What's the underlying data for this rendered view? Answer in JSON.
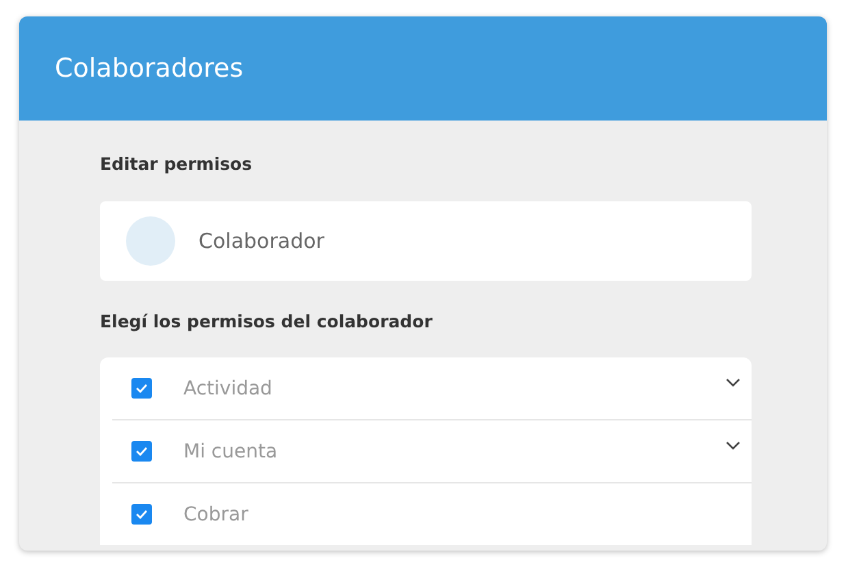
{
  "window": {
    "title": "Colaboradores"
  },
  "edit_section": {
    "heading": "Editar permisos",
    "collaborator": {
      "name": "Colaborador"
    }
  },
  "permissions_section": {
    "heading": "Elegí los permisos del colaborador",
    "items": [
      {
        "label": "Actividad",
        "checked": true,
        "expandable": true
      },
      {
        "label": "Mi cuenta",
        "checked": true,
        "expandable": true
      },
      {
        "label": "Cobrar",
        "checked": true,
        "expandable": false
      }
    ]
  }
}
